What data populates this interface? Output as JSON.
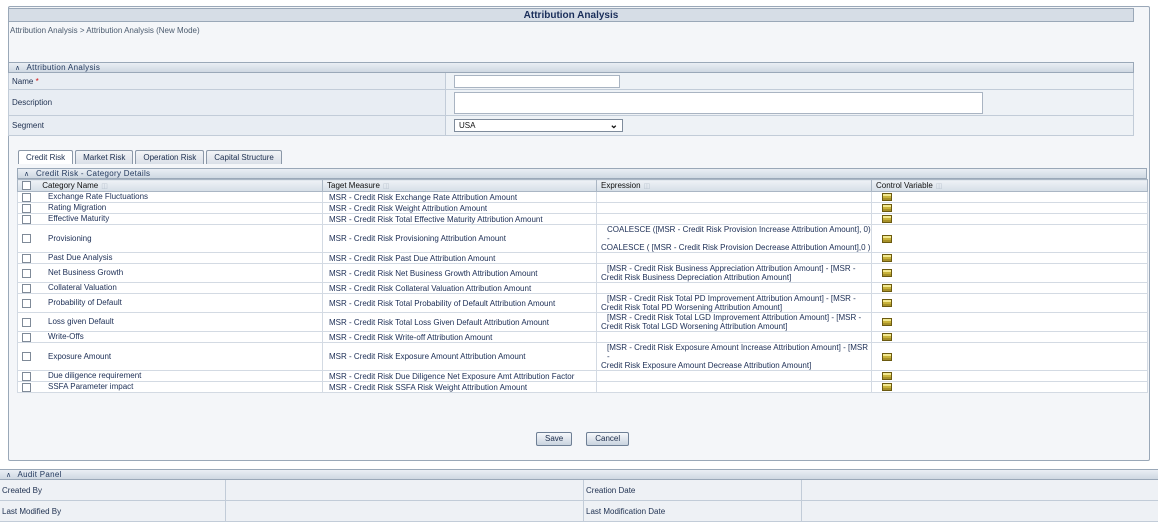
{
  "header": {
    "title": "Attribution Analysis",
    "breadcrumb": "Attribution Analysis > Attribution Analysis (New Mode)"
  },
  "form": {
    "section_title": "Attribution Analysis",
    "name_label": "Name",
    "required_mark": "*",
    "name_value": "",
    "description_label": "Description",
    "description_value": "",
    "segment_label": "Segment",
    "segment_value": "USA"
  },
  "tabs": [
    "Credit Risk",
    "Market Risk",
    "Operation Risk",
    "Capital Structure"
  ],
  "category": {
    "section_title": "Credit Risk - Category Details",
    "columns": [
      "Category Name",
      "Taget Measure",
      "Expression",
      "Control Variable"
    ],
    "rows": [
      {
        "name": "Exchange Rate Fluctuations",
        "measure": "MSR - Credit Risk Exchange Rate Attribution Amount",
        "expr1": "",
        "expr2": ""
      },
      {
        "name": "Rating Migration",
        "measure": "MSR - Credit Risk Weight Attribution Amount",
        "expr1": "",
        "expr2": ""
      },
      {
        "name": "Effective Maturity",
        "measure": "MSR - Credit Risk Total Effective Maturity Attribution Amount",
        "expr1": "",
        "expr2": ""
      },
      {
        "name": "Provisioning",
        "measure": "MSR - Credit Risk Provisioning Attribution Amount",
        "expr1": "COALESCE ([MSR - Credit Risk Provision Increase Attribution Amount], 0) -",
        "expr2": "COALESCE ( [MSR - Credit Risk Provision Decrease Attribution Amount],0 )"
      },
      {
        "name": "Past Due Analysis",
        "measure": "MSR - Credit Risk Past Due Attribution Amount",
        "expr1": "",
        "expr2": ""
      },
      {
        "name": "Net Business Growth",
        "measure": "MSR - Credit Risk Net Business Growth Attribution Amount",
        "expr1": "[MSR - Credit Risk Business Appreciation Attribution Amount] - [MSR -",
        "expr2": "Credit Risk Business Depreciation Attribution Amount]"
      },
      {
        "name": "Collateral Valuation",
        "measure": "MSR - Credit Risk Collateral Valuation Attribution Amount",
        "expr1": "",
        "expr2": ""
      },
      {
        "name": "Probability of Default",
        "measure": "MSR - Credit Risk Total Probability of Default Attribution Amount",
        "expr1": "[MSR - Credit Risk Total PD Improvement Attribution Amount] - [MSR -",
        "expr2": "Credit Risk Total PD Worsening Attribution Amount]"
      },
      {
        "name": "Loss given Default",
        "measure": "MSR - Credit Risk Total Loss Given Default Attribution Amount",
        "expr1": "[MSR - Credit Risk Total LGD Improvement Attribution Amount] - [MSR -",
        "expr2": "Credit Risk Total LGD Worsening Attribution Amount]"
      },
      {
        "name": "Write-Offs",
        "measure": "MSR - Credit Risk Write-off Attribution Amount",
        "expr1": "",
        "expr2": ""
      },
      {
        "name": "Exposure Amount",
        "measure": "MSR - Credit Risk Exposure Amount Attribution Amount",
        "expr1": "[MSR - Credit Risk Exposure Amount Increase Attribution Amount] - [MSR -",
        "expr2": "Credit Risk Exposure Amount Decrease Attribution Amount]"
      },
      {
        "name": "Due diligence requirement",
        "measure": "MSR - Credit Risk Due Diligence Net Exposure Amt Attribution Factor",
        "expr1": "",
        "expr2": ""
      },
      {
        "name": "SSFA Parameter impact",
        "measure": "MSR - Credit Risk SSFA Risk Weight Attribution Amount",
        "expr1": "",
        "expr2": ""
      }
    ]
  },
  "buttons": {
    "save": "Save",
    "cancel": "Cancel"
  },
  "audit": {
    "section_title": "Audit Panel",
    "created_by": "Created By",
    "creation_date": "Creation Date",
    "last_modified_by": "Last Modified By",
    "last_modification_date": "Last Modification Date"
  },
  "colors": {
    "accent": "#1a2e5a",
    "header_bg": "#d6dde6",
    "required": "#d01010"
  }
}
